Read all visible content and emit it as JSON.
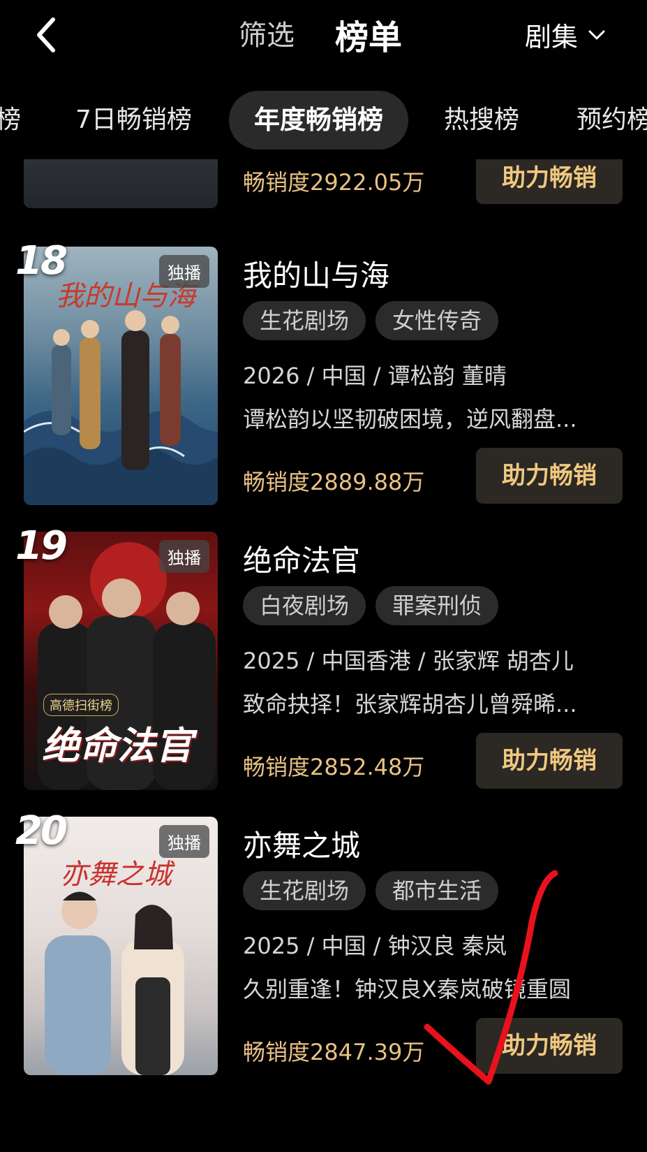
{
  "header": {
    "filter_label": "筛选",
    "title": "榜单",
    "category_label": "剧集"
  },
  "tabs": [
    {
      "label": "榜"
    },
    {
      "label": "7日畅销榜"
    },
    {
      "label": "年度畅销榜",
      "active": true
    },
    {
      "label": "热搜榜"
    },
    {
      "label": "预约榜"
    }
  ],
  "partial_item": {
    "sales": "畅销度2922.05万",
    "button": "助力畅销"
  },
  "items": [
    {
      "rank": "18",
      "badge": "独播",
      "poster_text": "我的山与海",
      "title": "我的山与海",
      "tags": [
        "生花剧场",
        "女性传奇"
      ],
      "meta": "2026 / 中国 / 谭松韵 董晴",
      "desc": "谭松韵以坚韧破困境，逆风翻盘...",
      "sales": "畅销度2889.88万",
      "button": "助力畅销"
    },
    {
      "rank": "19",
      "badge": "独播",
      "poster_text": "绝命法官",
      "poster_small": "高德扫街榜",
      "title": "绝命法官",
      "tags": [
        "白夜剧场",
        "罪案刑侦"
      ],
      "meta": "2025 / 中国香港 / 张家辉 胡杏儿",
      "desc": "致命抉择！张家辉胡杏儿曾舜晞...",
      "sales": "畅销度2852.48万",
      "button": "助力畅销"
    },
    {
      "rank": "20",
      "badge": "独播",
      "poster_text": "亦舞之城",
      "title": "亦舞之城",
      "tags": [
        "生花剧场",
        "都市生活"
      ],
      "meta": "2025 / 中国 / 钟汉良 秦岚",
      "desc": "久别重逢！钟汉良X秦岚破镜重圆",
      "sales": "畅销度2847.39万",
      "button": "助力畅销"
    }
  ],
  "colors": {
    "background": "#000000",
    "sales_text": "#e9c184",
    "button_bg": "#2c2823",
    "button_text": "#f0c880",
    "tag_bg": "#2b2b2b",
    "annotation_check": "#e8121c"
  },
  "icons": {
    "back": "chevron-left-icon",
    "category_dropdown": "chevron-down-icon"
  }
}
